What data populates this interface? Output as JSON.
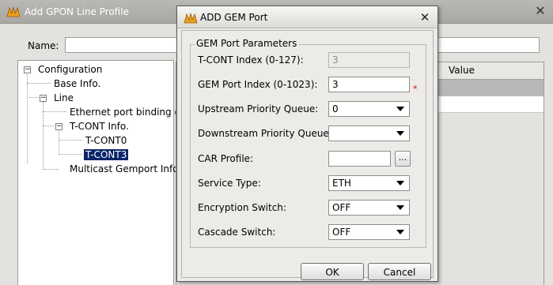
{
  "background_window": {
    "title": "Add GPON Line Profile",
    "close_glyph": "✕",
    "name_label": "Name:",
    "name_value": "",
    "tree": {
      "configuration": "Configuration",
      "base_info": "Base Info.",
      "line": "Line",
      "ethernet_binding": "Ethernet port binding gr",
      "tcont_info": "T-CONT Info.",
      "tcont0": "T-CONT0",
      "tcont3": "T-CONT3",
      "multicast": "Multicast Gemport Info",
      "expanded_glyph": "−"
    },
    "table": {
      "value_header": "Value"
    }
  },
  "dialog": {
    "title": "ADD GEM Port",
    "close_glyph": "✕",
    "group_title": "GEM Port Parameters",
    "fields": {
      "tcont_index": {
        "label": "T-CONT Index (0-127):",
        "value": "3"
      },
      "gem_port_index": {
        "label": "GEM Port Index (0-1023):",
        "value": "3",
        "required_marker": "*"
      },
      "upstream_queue": {
        "label": "Upstream Priority Queue:",
        "value": "0"
      },
      "downstream_queue": {
        "label": "Downstream Priority Queue:",
        "value": ""
      },
      "car_profile": {
        "label": "CAR Profile:",
        "value": "",
        "browse_label": "..."
      },
      "service_type": {
        "label": "Service Type:",
        "value": "ETH"
      },
      "encryption_switch": {
        "label": "Encryption Switch:",
        "value": "OFF"
      },
      "cascade_switch": {
        "label": "Cascade Switch:",
        "value": "OFF"
      }
    },
    "buttons": {
      "ok": "OK",
      "cancel": "Cancel"
    }
  },
  "icons": {
    "app_icon": "app-logo-icon",
    "dropdown_arrow": "chevron-down-icon"
  },
  "colors": {
    "selection_bg": "#0a246a",
    "required": "#e00000",
    "app_icon": "#e8a020"
  }
}
